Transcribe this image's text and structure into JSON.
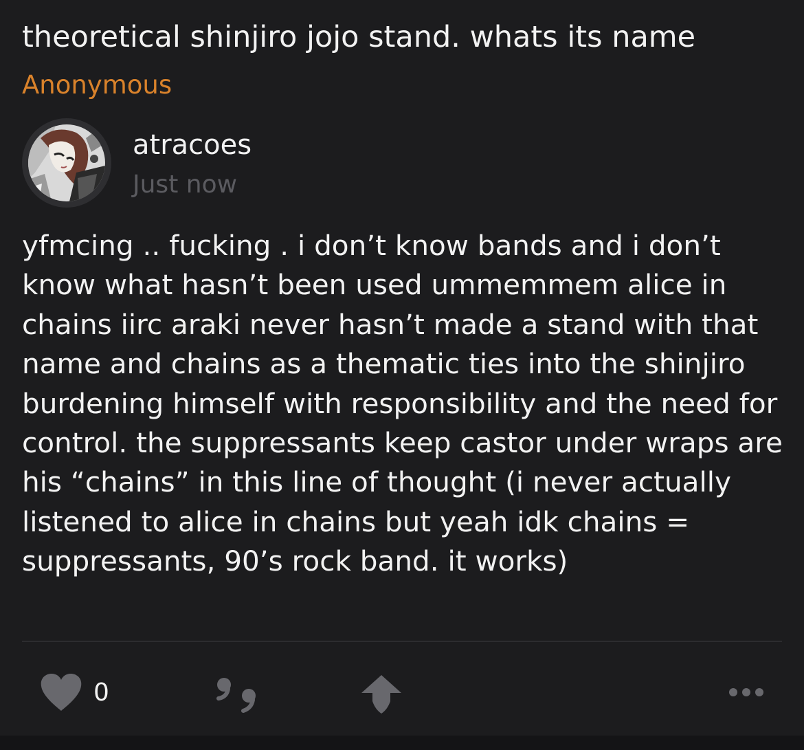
{
  "post": {
    "question": "theoretical shinjiro jojo stand. whats its name",
    "asker": "Anonymous",
    "author": {
      "username": "atracoes",
      "timestamp": "Just now",
      "avatar_icon": "profile-avatar-manga"
    },
    "answer": "yfmcing .. fucking . i don’t know bands and i don’t know what hasn’t been used ummemmem alice in chains iirc araki never hasn’t made a stand with that name and chains as a thematic ties into the shinjiro burdening himself with responsibility and the need for control. the suppressants keep castor under wraps are his “chains” in this line of thought (i never actually listened to alice in chains but yeah idk chains = suppressants, 90’s rock band. it works)"
  },
  "actions": {
    "like_icon": "heart-icon",
    "like_count": "0",
    "quote_icon": "quote-icon",
    "share_icon": "share-arrow-icon",
    "more_icon": "more-dots-icon"
  },
  "colors": {
    "background": "#1c1c1e",
    "asker_accent": "#d9822b",
    "text": "#f2f2f2",
    "muted": "#5b5b60",
    "icon": "#68686d"
  }
}
